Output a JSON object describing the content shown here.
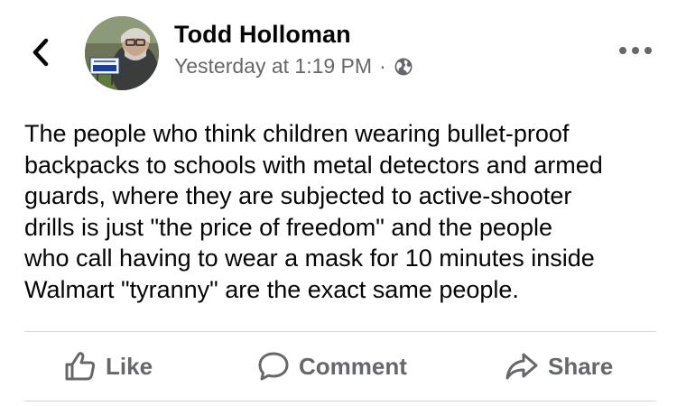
{
  "post": {
    "author_name": "Todd Holloman",
    "timestamp": "Yesterday at 1:19 PM",
    "meta_separator": "·",
    "privacy_icon": "globe-icon",
    "body": "The people who think children wearing bullet-proof\nbackpacks to schools with metal detectors and armed\nguards, where they are subjected to active-shooter\ndrills is just \"the price of freedom\" and the people\nwho call having to wear a mask for 10 minutes inside\nWalmart \"tyranny\" are the exact same people."
  },
  "header": {
    "back_icon": "chevron-left-icon",
    "more_icon": "more-horizontal-icon"
  },
  "actions": [
    {
      "label": "Like",
      "icon": "thumbs-up-icon"
    },
    {
      "label": "Comment",
      "icon": "comment-icon"
    },
    {
      "label": "Share",
      "icon": "share-arrow-icon"
    }
  ],
  "colors": {
    "text_primary": "#050505",
    "text_secondary": "#65676b",
    "divider": "#d4d6da"
  }
}
